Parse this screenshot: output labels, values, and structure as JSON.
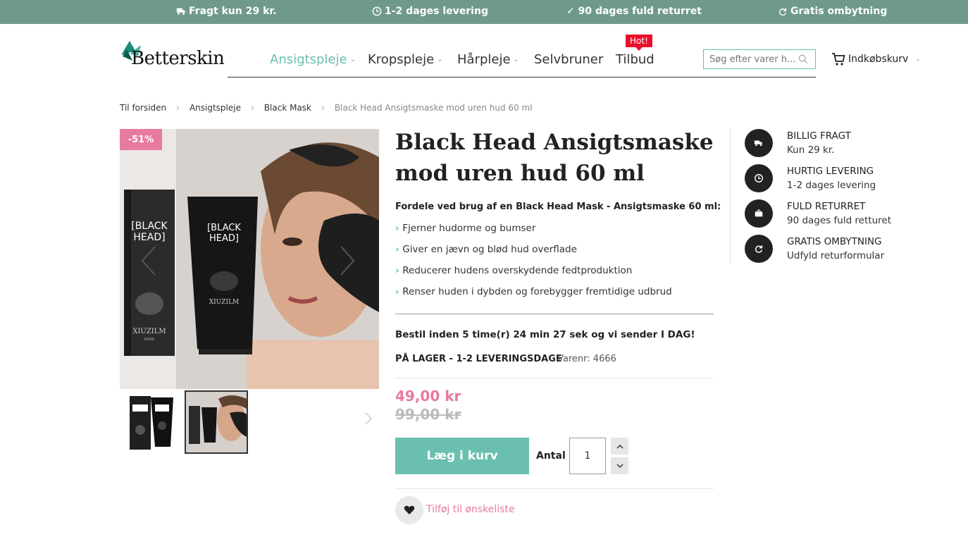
{
  "topbar": {
    "items": [
      {
        "icon": "truck-icon",
        "label": "Fragt kun 29 kr."
      },
      {
        "icon": "clock-icon",
        "label": "1-2 dages levering"
      },
      {
        "icon": "check-icon",
        "label": "✓ 90 dages fuld returret"
      },
      {
        "icon": "refresh-icon",
        "label": "Gratis ombytning"
      }
    ],
    "color": "#6f9a8a"
  },
  "header": {
    "logo_text": "Betterskin",
    "nav": [
      {
        "label": "Ansigtspleje",
        "active": true
      },
      {
        "label": "Kropspleje"
      },
      {
        "label": "Hårpleje"
      },
      {
        "label": "Selvbruner"
      },
      {
        "label": "Tilbud"
      }
    ],
    "hot_label": "Hot!",
    "search_placeholder": "Søg efter varer h...",
    "cart_label": "Indkøbskurv"
  },
  "breadcrumb": [
    "Til forsiden",
    "Ansigtspleje",
    "Black Mask",
    "Black Head Ansigtsmaske mod uren hud 60 ml"
  ],
  "product": {
    "discount_badge": "-51%",
    "title": "Black Head Ansigtsmaske mod uren hud 60 ml",
    "benefits_title": "Fordele ved brug af en Black Head Mask - Ansigtsmaske 60 ml:",
    "benefits": [
      "Fjerner hudorme og bumser",
      "Giver en jævn og blød hud overflade",
      "Reducerer hudens overskydende fedtproduktion",
      "Renser huden i dybden og forebygger fremtidige udbrud"
    ],
    "order_by": "Bestil inden 5 time(r) 24 min 27 sek og vi sender I DAG!",
    "stock": "PÅ LAGER - 1-2 LEVERINGSDAGE",
    "sku_label": "Varenr:",
    "sku": "4666",
    "price": "49,00 kr",
    "old_price": "99,00 kr",
    "add_to_cart": "Læg i kurv",
    "qty_label": "Antal",
    "qty_value": "1",
    "wishlist": "Tilføj til ønskeliste",
    "box_text": "[ BLACK HEAD ]",
    "brand": "XIUZILM",
    "brand_sub": "MASK"
  },
  "usps": [
    {
      "icon": "truck-icon",
      "title": "BILLIG FRAGT",
      "sub": "Kun 29 kr."
    },
    {
      "icon": "clock-icon",
      "title": "HURTIG LEVERING",
      "sub": "1-2 dages levering"
    },
    {
      "icon": "return-icon",
      "title": "FULD RETURRET",
      "sub": "90 dages fuld retturet"
    },
    {
      "icon": "refresh-icon",
      "title": "GRATIS OMBYTNING",
      "sub": "Udfyld returformular"
    }
  ],
  "colors": {
    "accent": "#6abfb0",
    "price": "#e67aa0",
    "hot": "#e8102a"
  }
}
